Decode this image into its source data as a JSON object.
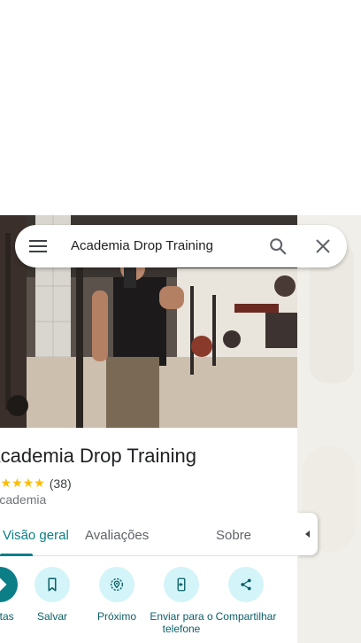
{
  "search": {
    "query": "Academia Drop Training"
  },
  "place": {
    "name": "Academia Drop Training",
    "rating_stars": "★★★★★",
    "rating_count": "(38)",
    "category": "Academia"
  },
  "tabs": [
    {
      "label": "Visão geral",
      "active": true
    },
    {
      "label": "Avaliações",
      "active": false
    },
    {
      "label": "Sobre",
      "active": false
    }
  ],
  "actions": [
    {
      "label": "Rotas",
      "icon": "directions-icon"
    },
    {
      "label": "Salvar",
      "icon": "bookmark-icon"
    },
    {
      "label": "Próximo",
      "icon": "nearby-icon"
    },
    {
      "label": "Enviar para o telefone",
      "icon": "send-to-phone-icon"
    },
    {
      "label": "Compartilhar",
      "icon": "share-icon"
    }
  ],
  "colors": {
    "accent": "#0b7e86",
    "action_bg": "#d3f4f8",
    "star": "#fbbc04"
  }
}
